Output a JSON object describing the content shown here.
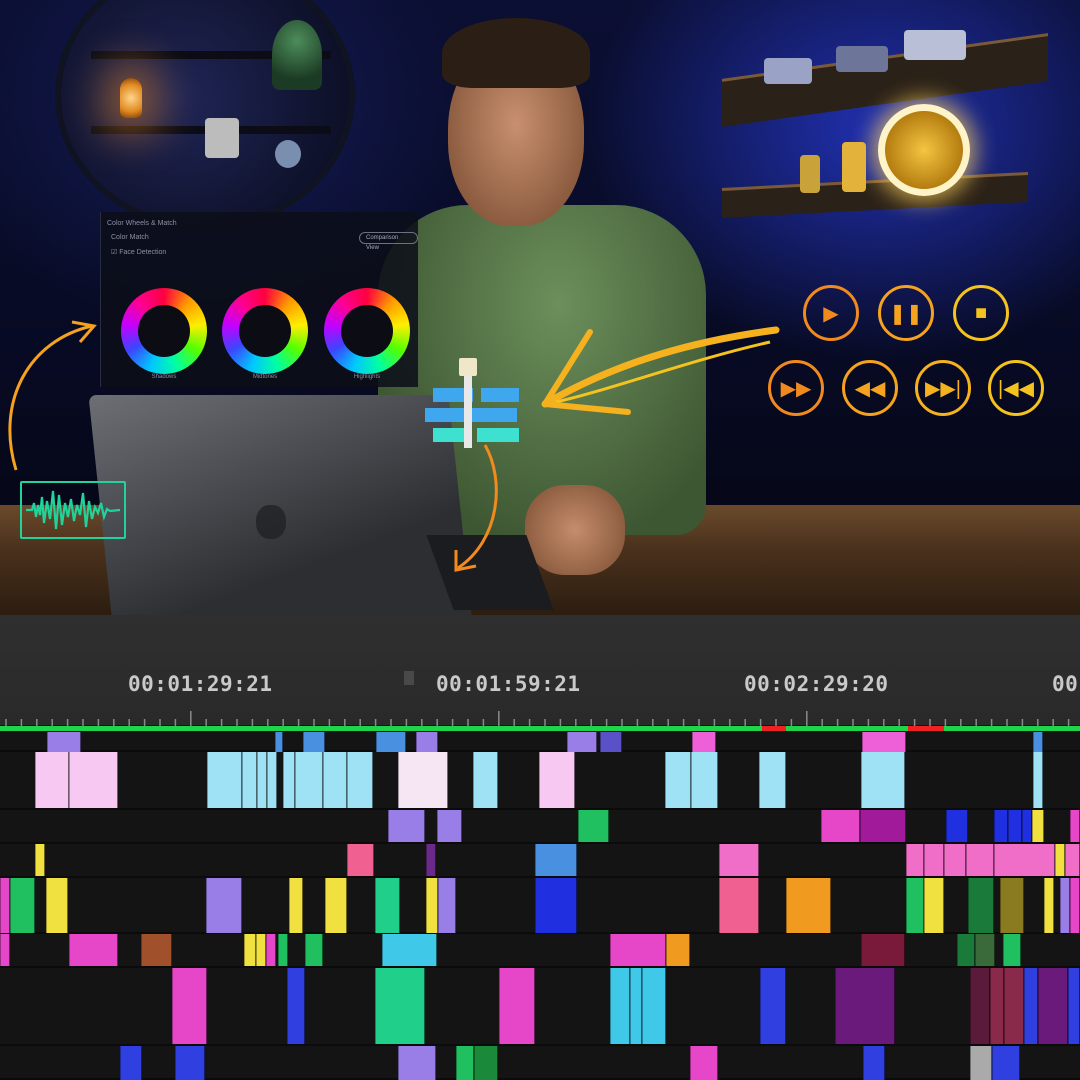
{
  "colors": {
    "timeline_bg": "#141414",
    "header_bg": "#2f2f2f",
    "timecode_text": "#c9c9c9",
    "work_area": "#1fd44a",
    "in_out_marker": "#ee2222",
    "overlay_orange": "#f08a1e",
    "overlay_yellow": "#f5c21e",
    "waveform_green": "#21d39a"
  },
  "overlay": {
    "color_panel": {
      "title": "Color Wheels & Match",
      "subtitle": "Color Match",
      "checkbox_label": "Face Detection",
      "button": "Comparison View",
      "wheels": [
        "Shadows",
        "Midtones",
        "Highlights"
      ]
    },
    "media_buttons": [
      "play",
      "pause",
      "stop",
      "fast-forward",
      "rewind",
      "skip-forward",
      "skip-back"
    ],
    "icons": [
      "waveform-icon",
      "essential-graphics-slider-icon",
      "curved-arrow-icon"
    ]
  },
  "timeline": {
    "timecodes": [
      "00:01:29:21",
      "00:01:59:21",
      "00:02:29:20",
      "00"
    ],
    "playhead_marker": "▌",
    "tracks": [
      {
        "row": 0,
        "clips": [
          [
            "#9a7ee8",
            47,
            34
          ],
          [
            "#4a90e0",
            275,
            8
          ],
          [
            "#4a90e0",
            303,
            22
          ],
          [
            "#4a90e0",
            376,
            30
          ],
          [
            "#9a7ee8",
            416,
            22
          ],
          [
            "#9a7ee8",
            567,
            30
          ],
          [
            "#5a50c8",
            600,
            22
          ],
          [
            "#ee60d8",
            692,
            24
          ],
          [
            "#ee60d8",
            862,
            44
          ],
          [
            "#4a90e0",
            1033,
            10
          ]
        ]
      },
      {
        "row": 1,
        "clips": [
          [
            "#f6c8f2",
            35,
            34
          ],
          [
            "#f6c8f2",
            69,
            49
          ],
          [
            "#9fe2f6",
            207,
            35
          ],
          [
            "#9fe2f6",
            242,
            15
          ],
          [
            "#9fe2f6",
            257,
            10
          ],
          [
            "#9fe2f6",
            267,
            10
          ],
          [
            "#9fe2f6",
            283,
            12
          ],
          [
            "#9fe2f6",
            295,
            28
          ],
          [
            "#9fe2f6",
            323,
            24
          ],
          [
            "#9fe2f6",
            347,
            26
          ],
          [
            "#f6e6f4",
            398,
            50
          ],
          [
            "#9fe2f6",
            473,
            25
          ],
          [
            "#f6c8f2",
            539,
            36
          ],
          [
            "#9fe2f6",
            665,
            26
          ],
          [
            "#9fe2f6",
            691,
            27
          ],
          [
            "#9fe2f6",
            759,
            27
          ],
          [
            "#9fe2f6",
            861,
            44
          ],
          [
            "#9fe2f6",
            1033,
            10
          ]
        ]
      },
      {
        "row": 2,
        "clips": [
          [
            "#9a7ee8",
            388,
            37
          ],
          [
            "#9a7ee8",
            437,
            25
          ],
          [
            "#20c060",
            578,
            31
          ],
          [
            "#e646c8",
            821,
            39
          ],
          [
            "#a01a9a",
            860,
            46
          ],
          [
            "#2030e0",
            946,
            22
          ],
          [
            "#2030e0",
            994,
            14
          ],
          [
            "#2030e0",
            1008,
            14
          ],
          [
            "#2030e0",
            1022,
            10
          ],
          [
            "#f0e040",
            1032,
            12
          ],
          [
            "#e646c8",
            1070,
            10
          ]
        ]
      },
      {
        "row": 3,
        "clips": [
          [
            "#f0e040",
            35,
            10
          ],
          [
            "#f06090",
            347,
            27
          ],
          [
            "#6a2a8a",
            426,
            10
          ],
          [
            "#4a90e0",
            535,
            42
          ],
          [
            "#f06ec8",
            719,
            40
          ],
          [
            "#f06ec8",
            906,
            18
          ],
          [
            "#f06ec8",
            924,
            20
          ],
          [
            "#f06ec8",
            944,
            22
          ],
          [
            "#f06ec8",
            966,
            28
          ],
          [
            "#f06ec8",
            994,
            61
          ],
          [
            "#f0e040",
            1055,
            10
          ],
          [
            "#f06ec8",
            1065,
            15
          ]
        ]
      },
      {
        "row": 4,
        "clips": [
          [
            "#e646c8",
            0,
            10
          ],
          [
            "#20c060",
            10,
            25
          ],
          [
            "#f0e040",
            46,
            22
          ],
          [
            "#9a7ee8",
            206,
            36
          ],
          [
            "#f0e040",
            289,
            14
          ],
          [
            "#f0e040",
            325,
            22
          ],
          [
            "#20d08a",
            375,
            25
          ],
          [
            "#f0e040",
            426,
            12
          ],
          [
            "#9a7ee8",
            438,
            18
          ],
          [
            "#2030e0",
            535,
            42
          ],
          [
            "#f06090",
            719,
            40
          ],
          [
            "#f09a20",
            786,
            45
          ],
          [
            "#20c060",
            906,
            18
          ],
          [
            "#f0e040",
            924,
            20
          ],
          [
            "#1a7a3a",
            968,
            26
          ],
          [
            "#8a7a20",
            1000,
            24
          ],
          [
            "#f0e040",
            1044,
            10
          ],
          [
            "#9a7ee8",
            1060,
            10
          ],
          [
            "#e646c8",
            1070,
            10
          ]
        ]
      },
      {
        "row": 5,
        "clips": [
          [
            "#e646c8",
            0,
            10
          ],
          [
            "#e646c8",
            69,
            49
          ],
          [
            "#a0502a",
            141,
            31
          ],
          [
            "#f0e040",
            244,
            12
          ],
          [
            "#f0e040",
            256,
            10
          ],
          [
            "#e646c8",
            266,
            10
          ],
          [
            "#20c060",
            278,
            10
          ],
          [
            "#20c060",
            305,
            18
          ],
          [
            "#40c8e8",
            382,
            55
          ],
          [
            "#e646c8",
            610,
            56
          ],
          [
            "#f09a20",
            666,
            24
          ],
          [
            "#7a1a3a",
            861,
            44
          ],
          [
            "#1a7a3a",
            957,
            18
          ],
          [
            "#3a6a3a",
            975,
            20
          ],
          [
            "#20c060",
            1003,
            18
          ]
        ]
      },
      {
        "row": 6,
        "clips": [
          [
            "#e646c8",
            172,
            35
          ],
          [
            "#3040e0",
            287,
            18
          ],
          [
            "#20d08a",
            375,
            50
          ],
          [
            "#e646c8",
            499,
            36
          ],
          [
            "#40c8e8",
            610,
            20
          ],
          [
            "#40c8e8",
            630,
            12
          ],
          [
            "#40c8e8",
            642,
            24
          ],
          [
            "#3040e0",
            760,
            26
          ],
          [
            "#6a1a7a",
            835,
            60
          ],
          [
            "#5a1a3a",
            970,
            20
          ],
          [
            "#8a2a4a",
            990,
            14
          ],
          [
            "#8a2a4a",
            1004,
            20
          ],
          [
            "#3040e0",
            1024,
            14
          ],
          [
            "#6a1a7a",
            1038,
            30
          ],
          [
            "#3040e0",
            1068,
            12
          ]
        ]
      },
      {
        "row": 7,
        "clips": [
          [
            "#3040e0",
            120,
            22
          ],
          [
            "#3040e0",
            175,
            30
          ],
          [
            "#9a7ee8",
            398,
            38
          ],
          [
            "#20c060",
            456,
            18
          ],
          [
            "#1a8a3a",
            474,
            24
          ],
          [
            "#e646c8",
            690,
            28
          ],
          [
            "#3040e0",
            863,
            22
          ],
          [
            "#aaaaaa",
            970,
            22
          ],
          [
            "#3040e0",
            992,
            28
          ]
        ]
      }
    ]
  }
}
